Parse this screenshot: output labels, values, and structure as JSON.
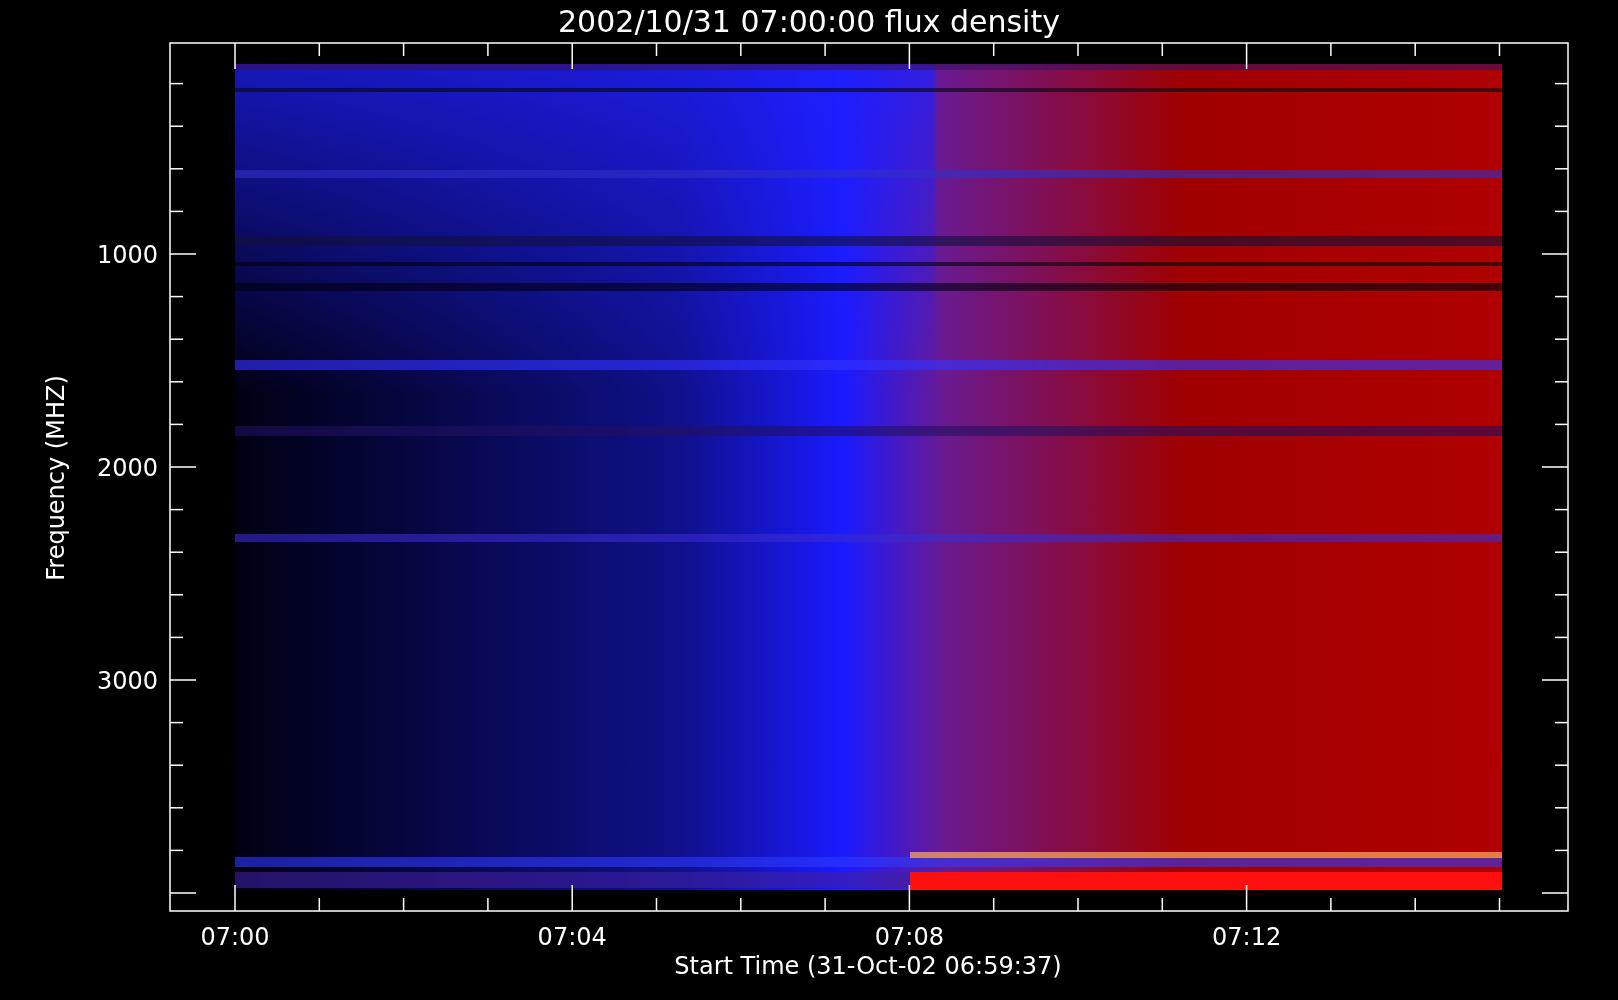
{
  "title": "2002/10/31 07:00:00 flux density",
  "y_axis": {
    "label": "Frequency (MHZ)",
    "tick_labels": [
      "1000",
      "2000",
      "3000"
    ]
  },
  "x_axis": {
    "label": "Start Time (31-Oct-02 06:59:37)",
    "tick_labels": [
      "07:00",
      "07:04",
      "07:08",
      "07:12"
    ]
  }
}
